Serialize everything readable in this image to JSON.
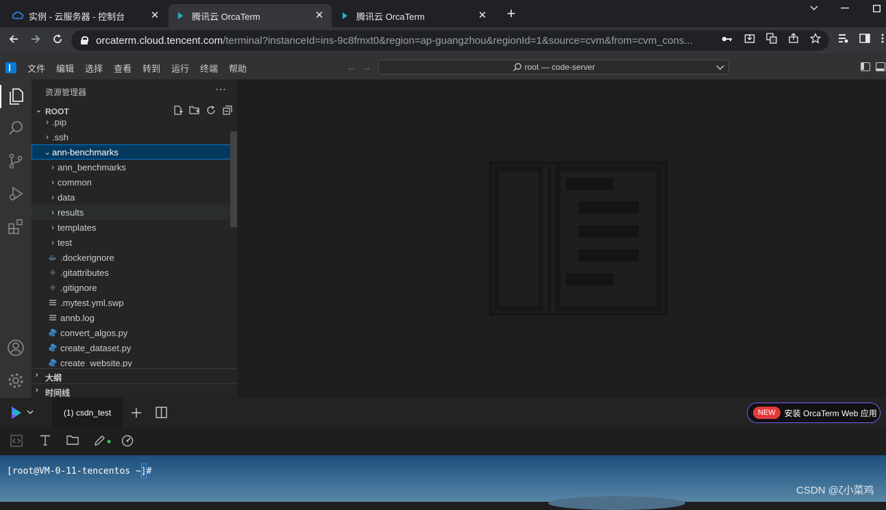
{
  "browser": {
    "tabs": [
      {
        "title": "实例 - 云服务器 - 控制台",
        "icon": "tencent-cloud-icon",
        "active": false
      },
      {
        "title": "腾讯云 OrcaTerm",
        "icon": "orcaterm-icon",
        "active": true
      },
      {
        "title": "腾讯云 OrcaTerm",
        "icon": "orcaterm-icon",
        "active": false
      }
    ],
    "close_glyph": "✕",
    "new_tab_glyph": "+",
    "url_host": "orcaterm.cloud.tencent.com",
    "url_path": "/terminal?instanceId=ins-9c8fmxt0&region=ap-guangzhou&regionId=1&source=cvm&from=cvm_cons..."
  },
  "vscode": {
    "menu": [
      "文件",
      "编辑",
      "选择",
      "查看",
      "转到",
      "运行",
      "终端",
      "帮助"
    ],
    "command_center": "root — code-server",
    "explorer_title": "资源管理器",
    "explorer_more": "···",
    "root_label": "ROOT",
    "tree": [
      {
        "label": ".pip",
        "type": "folder",
        "depth": 0,
        "expanded": false
      },
      {
        "label": ".ssh",
        "type": "folder",
        "depth": 0,
        "expanded": false
      },
      {
        "label": "ann-benchmarks",
        "type": "folder",
        "depth": 0,
        "expanded": true,
        "selected": true
      },
      {
        "label": "ann_benchmarks",
        "type": "folder",
        "depth": 1,
        "expanded": false
      },
      {
        "label": "common",
        "type": "folder",
        "depth": 1,
        "expanded": false
      },
      {
        "label": "data",
        "type": "folder",
        "depth": 1,
        "expanded": false
      },
      {
        "label": "results",
        "type": "folder",
        "depth": 1,
        "expanded": false,
        "hover": true
      },
      {
        "label": "templates",
        "type": "folder",
        "depth": 1,
        "expanded": false
      },
      {
        "label": "test",
        "type": "folder",
        "depth": 1,
        "expanded": false
      },
      {
        "label": ".dockerignore",
        "type": "docker",
        "depth": 1
      },
      {
        "label": ".gitattributes",
        "type": "git",
        "depth": 1
      },
      {
        "label": ".gitignore",
        "type": "git",
        "depth": 1
      },
      {
        "label": ".mytest.yml.swp",
        "type": "text",
        "depth": 1
      },
      {
        "label": "annb.log",
        "type": "text",
        "depth": 1
      },
      {
        "label": "convert_algos.py",
        "type": "python",
        "depth": 1
      },
      {
        "label": "create_dataset.py",
        "type": "python",
        "depth": 1
      },
      {
        "label": "create_website.py",
        "type": "python",
        "depth": 1
      }
    ],
    "outline_label": "大纲",
    "timeline_label": "时间线",
    "colors": {
      "accent": "#0078d4",
      "selection": "#04395e",
      "python": "#3b8bd6"
    }
  },
  "orcaterm": {
    "session_tab": "(1) csdn_test",
    "new_badge": "NEW",
    "install_label": "安装 OrcaTerm Web 应用",
    "prompt": "[root@VM-0-11-tencentos ~]#",
    "watermark": "CSDN @ζ小菜鸡"
  }
}
